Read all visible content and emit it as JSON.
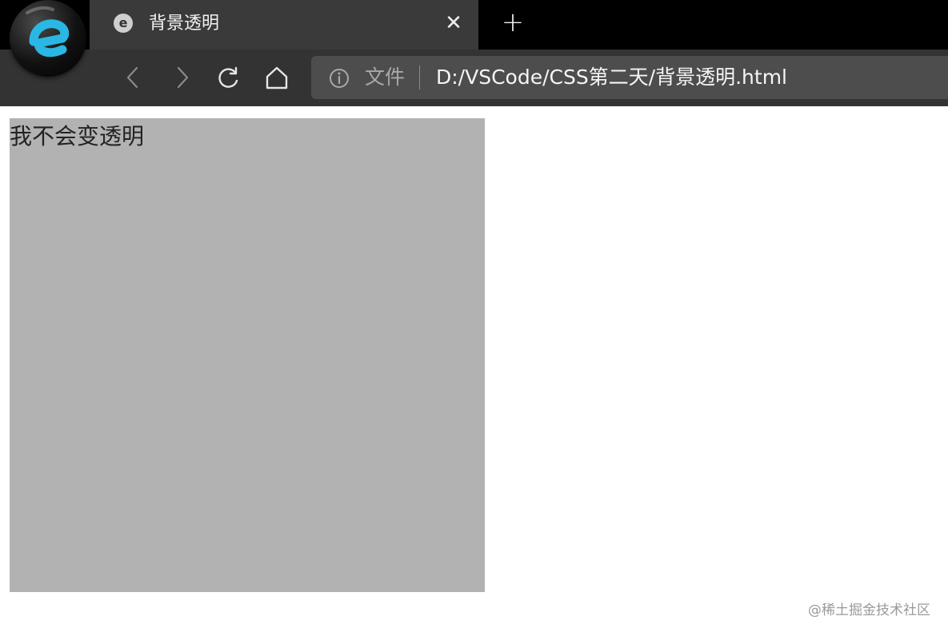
{
  "tab": {
    "favicon_glyph": "e",
    "title": "背景透明",
    "close_glyph": "✕",
    "new_tab_glyph": "+"
  },
  "address_bar": {
    "scheme_label": "文件",
    "url": "D:/VSCode/CSS第二天/背景透明.html"
  },
  "page": {
    "box_text": "我不会变透明",
    "box_color": "#b2b2b2"
  },
  "watermark": "@稀土掘金技术社区",
  "colors": {
    "chrome_bg": "#333333",
    "tab_strip_bg": "#000000",
    "logo_accent": "#2ab7e4"
  },
  "icons": {
    "logo": "edge-logo-icon",
    "back": "chevron-left-icon",
    "forward": "chevron-right-icon",
    "reload": "reload-icon",
    "home": "home-icon",
    "info": "info-icon"
  }
}
